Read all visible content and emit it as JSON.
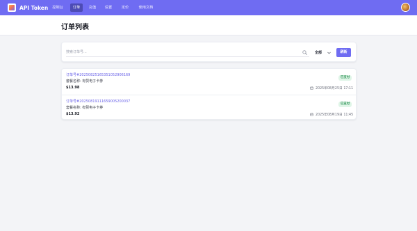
{
  "brand": {
    "name": "API Token"
  },
  "nav": {
    "items": [
      {
        "label": "控制台",
        "active": false
      },
      {
        "label": "订单",
        "active": true
      },
      {
        "label": "充值",
        "active": false
      },
      {
        "label": "设置",
        "active": false
      },
      {
        "label": "定价",
        "active": false
      },
      {
        "label": "使用文档",
        "active": false
      }
    ]
  },
  "page": {
    "title": "订单列表"
  },
  "search": {
    "placeholder": "搜索订单号...",
    "value": "",
    "filter_selected": "全部",
    "refresh_label": "刷新"
  },
  "orders": [
    {
      "order_no": "订单号#2025082516535105290616​9",
      "name": "套餐名称: 有赞电子卡券",
      "price": "$13.98",
      "status": "已支付",
      "date": "2025年08月25日 17:11"
    },
    {
      "order_no": "订单号#202508191116590052000​37",
      "name": "套餐名称: 有赞电子卡券",
      "price": "$13.92",
      "status": "已支付",
      "date": "2025年08月19日 11:45"
    }
  ],
  "colors": {
    "accent": "#6f6cf2",
    "status_paid_bg": "#dff5e7",
    "status_paid_text": "#1f8a4a",
    "order_link": "#6a63e8"
  }
}
